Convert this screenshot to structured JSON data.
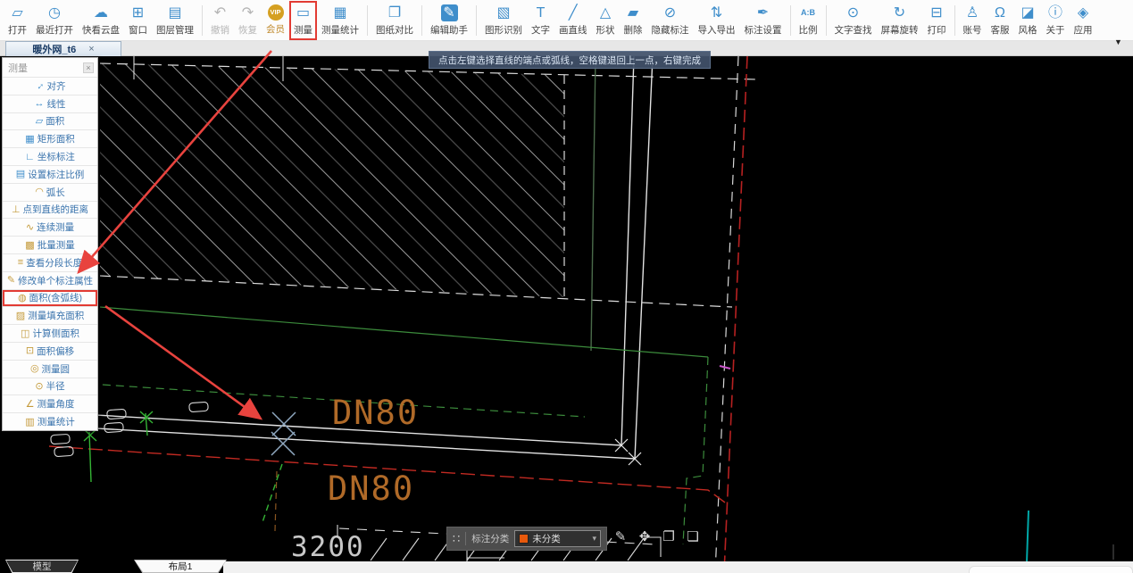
{
  "toolbar": {
    "items": [
      {
        "label": "打开",
        "icon": "open-folder-icon"
      },
      {
        "label": "最近打开",
        "icon": "recent-clock-icon"
      },
      {
        "label": "快看云盘",
        "icon": "cloud-icon"
      },
      {
        "label": "窗口",
        "icon": "window-icon"
      },
      {
        "label": "图层管理",
        "icon": "layers-icon"
      },
      {
        "type": "sep"
      },
      {
        "label": "撤销",
        "icon": "undo-icon",
        "state": "disabled"
      },
      {
        "label": "恢复",
        "icon": "redo-icon",
        "state": "disabled"
      },
      {
        "label": "会员",
        "icon": "vip-icon",
        "state": "gold"
      },
      {
        "label": "测量",
        "icon": "measure-icon",
        "state": "highlight"
      },
      {
        "label": "测量统计",
        "icon": "measure-stats-icon"
      },
      {
        "type": "sep"
      },
      {
        "label": "图纸对比",
        "icon": "compare-icon"
      },
      {
        "type": "sep"
      },
      {
        "label": "编辑助手",
        "icon": "edit-assistant-icon",
        "state": "filled"
      },
      {
        "type": "sep"
      },
      {
        "label": "图形识别",
        "icon": "shape-recognize-icon"
      },
      {
        "label": "文字",
        "icon": "text-icon"
      },
      {
        "label": "画直线",
        "icon": "draw-line-icon"
      },
      {
        "label": "形状",
        "icon": "shapes-icon"
      },
      {
        "label": "删除",
        "icon": "eraser-icon"
      },
      {
        "label": "隐藏标注",
        "icon": "hide-annotation-icon"
      },
      {
        "label": "导入导出",
        "icon": "import-export-icon"
      },
      {
        "label": "标注设置",
        "icon": "annotation-settings-icon"
      },
      {
        "type": "sep"
      },
      {
        "label": "比例",
        "icon": "scale-ratio-icon"
      },
      {
        "type": "sep"
      },
      {
        "label": "文字查找",
        "icon": "text-search-icon"
      },
      {
        "label": "屏幕旋转",
        "icon": "screen-rotate-icon"
      },
      {
        "label": "打印",
        "icon": "print-icon"
      },
      {
        "type": "sep"
      },
      {
        "label": "账号",
        "icon": "account-icon"
      },
      {
        "label": "客服",
        "icon": "support-icon"
      },
      {
        "label": "风格",
        "icon": "style-icon"
      },
      {
        "label": "关于",
        "icon": "about-icon"
      },
      {
        "label": "应用",
        "icon": "apps-icon"
      }
    ],
    "collapse_icon": "collapse-icon"
  },
  "tabbar": {
    "active_tab": "暖外网_t6",
    "close_glyph": "×"
  },
  "tooltip": {
    "text": "点击左键选择直线的端点或弧线，空格键退回上一点，右键完成"
  },
  "measure_panel": {
    "title": "测量",
    "close_glyph": "×",
    "items": [
      {
        "label": "对齐",
        "icon": "align-icon",
        "tier": "blue"
      },
      {
        "label": "线性",
        "icon": "linear-icon",
        "tier": "blue"
      },
      {
        "label": "面积",
        "icon": "area-icon",
        "tier": "blue"
      },
      {
        "label": "矩形面积",
        "icon": "rect-area-icon",
        "tier": "blue"
      },
      {
        "label": "坐标标注",
        "icon": "coordinate-icon",
        "tier": "blue"
      },
      {
        "label": "设置标注比例",
        "icon": "scale-setting-icon",
        "tier": "blue"
      },
      {
        "label": "弧长",
        "icon": "arc-length-icon",
        "tier": "gold"
      },
      {
        "label": "点到直线的距离",
        "icon": "point-to-line-icon",
        "tier": "gold"
      },
      {
        "label": "连续测量",
        "icon": "continuous-measure-icon",
        "tier": "gold"
      },
      {
        "label": "批量测量",
        "icon": "batch-measure-icon",
        "tier": "gold"
      },
      {
        "label": "查看分段长度",
        "icon": "segment-length-icon",
        "tier": "gold"
      },
      {
        "label": "修改单个标注属性",
        "icon": "modify-annotation-icon",
        "tier": "gold"
      },
      {
        "label": "面积(含弧线)",
        "icon": "area-with-arc-icon",
        "tier": "gold",
        "highlighted": true
      },
      {
        "label": "测量填充面积",
        "icon": "fill-area-icon",
        "tier": "gold"
      },
      {
        "label": "计算侧面积",
        "icon": "side-area-icon",
        "tier": "gold"
      },
      {
        "label": "面积偏移",
        "icon": "area-offset-icon",
        "tier": "gold"
      },
      {
        "label": "测量圆",
        "icon": "measure-circle-icon",
        "tier": "gold"
      },
      {
        "label": "半径",
        "icon": "radius-icon",
        "tier": "gold"
      },
      {
        "label": "测量角度",
        "icon": "measure-angle-icon",
        "tier": "gold"
      },
      {
        "label": "测量统计",
        "icon": "measure-stat-icon",
        "tier": "gold"
      }
    ]
  },
  "drawing": {
    "pipe_label_1": "DN80",
    "pipe_label_2": "DN80",
    "dimension_label": "3200"
  },
  "bottom_toolbar": {
    "grid_icon": "grid-icon",
    "category_label": "标注分类",
    "dropdown": {
      "selected": "未分类",
      "swatch_color": "#E8590C",
      "caret_icon": "caret-down-icon"
    },
    "icons": [
      "edit-note-icon",
      "move-icon",
      "copy-icon",
      "paste-icon"
    ]
  },
  "sheet_tabs": {
    "model": "模型",
    "layout": "布局1"
  },
  "colors": {
    "accent_blue": "#3F8ECB",
    "gold": "#C49A3A",
    "highlight_red": "#E23B33",
    "pipe_label_orange": "#B06A28",
    "dimension_gray": "#C8C8C8",
    "canvas_bg": "#000000"
  }
}
